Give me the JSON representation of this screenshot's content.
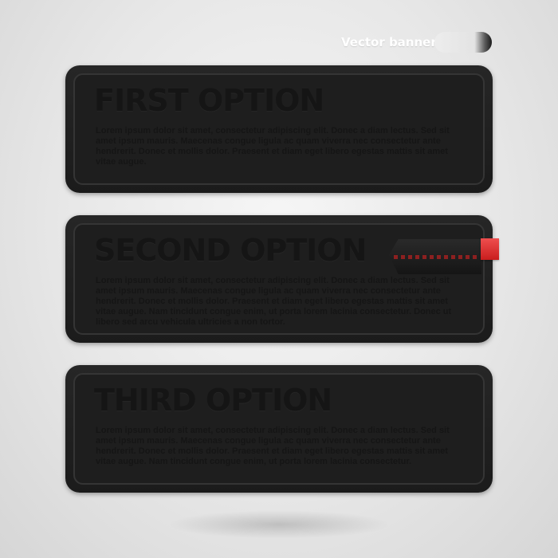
{
  "header": {
    "label": "Vector banners"
  },
  "banners": [
    {
      "title": "FIRST OPTION",
      "text": "Lorem ipsum dolor sit amet, consectetur adipiscing elit. Donec a diam lectus. Sed sit amet ipsum mauris. Maecenas congue ligula ac quam viverra nec consectetur ante hendrerit. Donec et mollis dolor. Praesent et diam eget libero egestas mattis sit amet vitae augue."
    },
    {
      "title": "SECOND OPTION",
      "text": "Lorem ipsum dolor sit amet, consectetur adipiscing elit. Donec a diam lectus. Sed sit amet ipsum mauris. Maecenas congue ligula ac quam viverra nec consectetur ante hendrerit. Donec et mollis dolor. Praesent et diam eget libero egestas mattis sit amet vitae augue. Nam tincidunt congue enim, ut porta lorem lacinia consectetur. Donec ut libero sed arcu vehicula ultricies a non tortor."
    },
    {
      "title": "THIRD OPTION",
      "text": "Lorem ipsum dolor sit amet, consectetur adipiscing elit. Donec a diam lectus. Sed sit amet ipsum mauris. Maecenas congue ligula ac quam viverra nec consectetur ante hendrerit. Donec et mollis dolor. Praesent et diam eget libero egestas mattis sit amet vitae augue. Nam tincidunt congue enim, ut porta lorem lacinia consectetur."
    }
  ],
  "colors": {
    "banner_fill": "#1e1e1e",
    "banner_border": "#353535",
    "accent_red": "#d92b2b"
  }
}
